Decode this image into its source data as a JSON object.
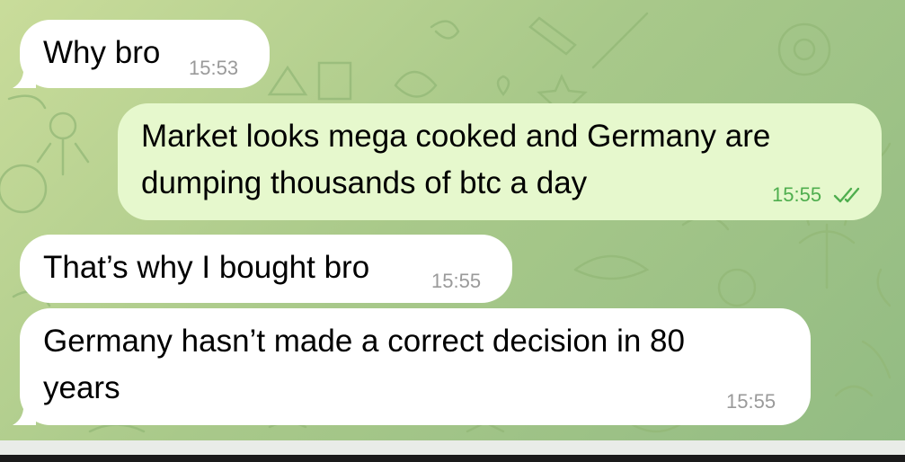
{
  "chat": {
    "messages": [
      {
        "direction": "incoming",
        "text_lines": [
          "Why bro"
        ],
        "time": "15:53"
      },
      {
        "direction": "outgoing",
        "text_lines": [
          "Market looks mega cooked and Germany are",
          "dumping thousands of btc a day"
        ],
        "time": "15:55",
        "status_icon": "double-check-icon"
      },
      {
        "direction": "incoming",
        "text_lines": [
          "That’s why I bought bro"
        ],
        "time": "15:55"
      },
      {
        "direction": "incoming",
        "text_lines": [
          "Germany hasn’t made a correct decision in 80",
          "years"
        ],
        "time": "15:55"
      }
    ]
  },
  "colors": {
    "incoming_bubble": "#ffffff",
    "outgoing_bubble": "#e6f8cd",
    "outgoing_time": "#4fae4e",
    "incoming_time": "#9a9a9a",
    "wallpaper": "#a9c98a"
  }
}
